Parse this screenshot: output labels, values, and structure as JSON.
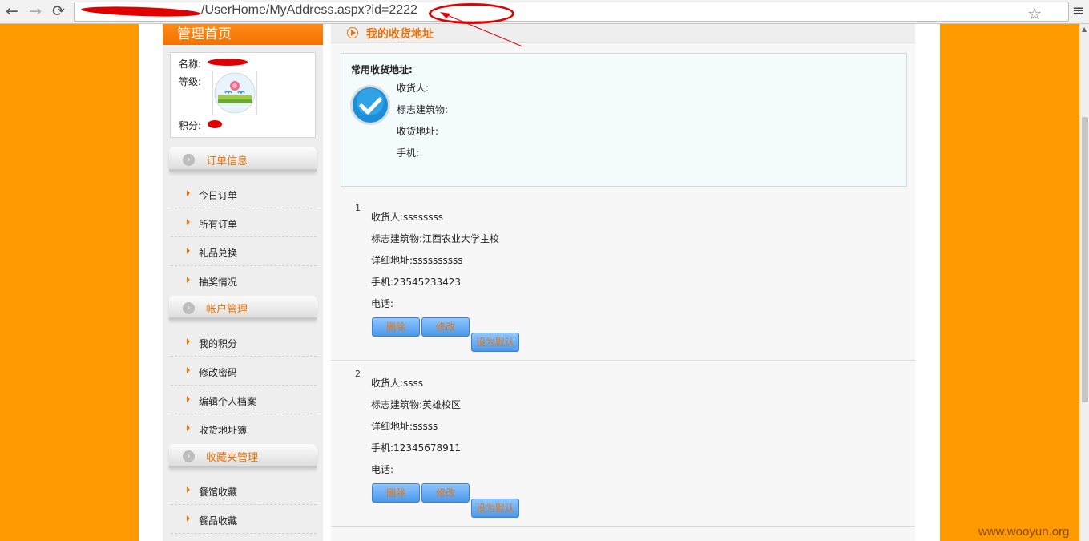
{
  "browser": {
    "url_visible": "/UserHome/MyAddress.aspx?id=2222",
    "back_icon": "←",
    "forward_icon": "→",
    "reload_icon": "⟳",
    "star_icon": "☆",
    "menu_icon": "≡",
    "annotation_color": "#e00000"
  },
  "sidebar": {
    "title": "管理首页",
    "user": {
      "name_label": "名称:",
      "level_label": "等级:",
      "points_label": "积分:"
    },
    "sections": [
      {
        "label": "订单信息",
        "items": [
          "今日订单",
          "所有订单",
          "礼品兑换",
          "抽奖情况"
        ]
      },
      {
        "label": "帐户管理",
        "items": [
          "我的积分",
          "修改密码",
          "编辑个人档案",
          "收货地址簿"
        ]
      },
      {
        "label": "收藏夹管理",
        "items": [
          "餐馆收藏",
          "餐品收藏"
        ]
      }
    ]
  },
  "main": {
    "title": "我的收货地址",
    "default_address": {
      "heading": "常用收货地址:",
      "lines": [
        "收货人:",
        "标志建筑物:",
        "收货地址:",
        "手机:"
      ]
    },
    "addresses": [
      {
        "num": "1",
        "receiver": "收货人:ssssssss",
        "landmark": "标志建筑物:江西农业大学主校",
        "detail": "详细地址:ssssssssss",
        "mobile": "手机:23545233423",
        "phone": "电话:"
      },
      {
        "num": "2",
        "receiver": "收货人:ssss",
        "landmark": "标志建筑物:英雄校区",
        "detail": "详细地址:sssss",
        "mobile": "手机:12345678911",
        "phone": "电话:"
      }
    ],
    "buttons": {
      "delete": "删除",
      "edit": "修改",
      "set_default": "设为默认"
    }
  },
  "watermark": "www.wooyun.org",
  "colors": {
    "page_bg": "#ff9900",
    "accent": "#e8730c",
    "button": "#4a98ea"
  }
}
